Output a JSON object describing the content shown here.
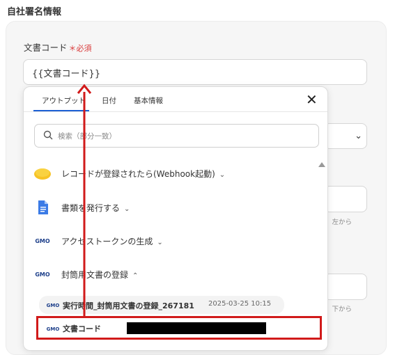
{
  "section": {
    "title": "自社署名情報"
  },
  "field": {
    "label": "文書コード",
    "required": "＊必須",
    "value": "{{文書コード}}"
  },
  "background": {
    "hint1": "、左から",
    "hint2": "、下から"
  },
  "dropdown": {
    "tabs": [
      {
        "label": "アウトプット"
      },
      {
        "label": "日付"
      },
      {
        "label": "基本情報"
      }
    ],
    "search_placeholder": "検索（部分一致）",
    "groups": [
      {
        "label": "レコードが登録されたら(Webhook起動)",
        "icon": "kintone-icon"
      },
      {
        "label": "書類を発行する",
        "icon": "google-docs-icon"
      },
      {
        "label": "アクセストークンの生成",
        "icon": "gmo-sign-icon"
      },
      {
        "label": "封筒用文書の登録",
        "icon": "gmo-sign-icon"
      }
    ],
    "outputs": [
      {
        "label": "実行時間_封筒用文書の登録_267181",
        "value": "2025-03-25 10:15"
      },
      {
        "label": "文書コード",
        "value": ""
      }
    ]
  },
  "colors": {
    "accent": "#1b5fd4",
    "highlight": "#d11a1a",
    "required": "#d93a3a"
  }
}
